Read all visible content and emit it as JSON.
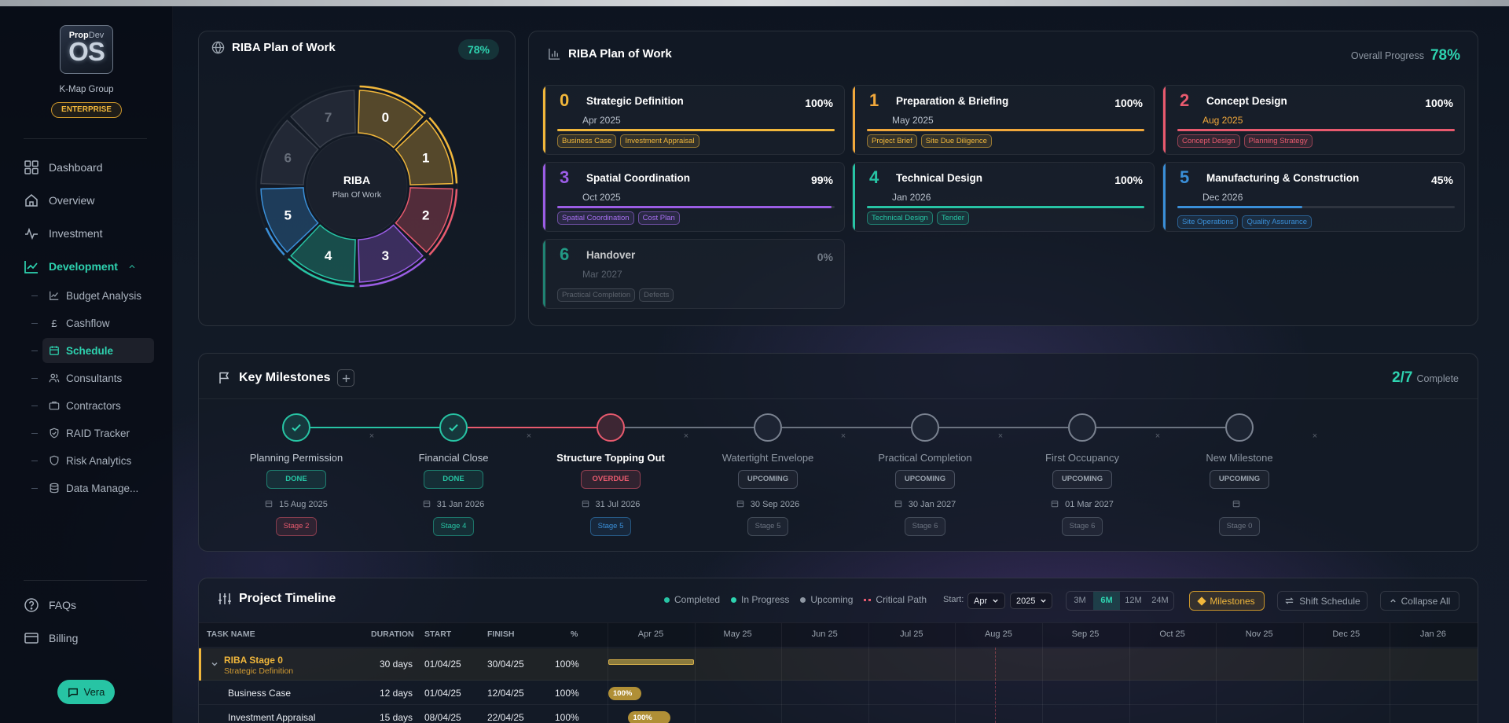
{
  "sidebar": {
    "logo_top": "Prop",
    "logo_top2": "Dev",
    "logo_main": "OS",
    "org": "K-Map Group",
    "plan": "ENTERPRISE",
    "nav": {
      "dashboard": "Dashboard",
      "overview": "Overview",
      "investment": "Investment",
      "development": "Development"
    },
    "sub": {
      "budget": "Budget Analysis",
      "cashflow": "Cashflow",
      "schedule": "Schedule",
      "consultants": "Consultants",
      "contractors": "Contractors",
      "raid": "RAID Tracker",
      "risk": "Risk Analytics",
      "data": "Data Manage..."
    },
    "faqs": "FAQs",
    "billing": "Billing",
    "vera": "Vera"
  },
  "wheel": {
    "title": "RIBA Plan of Work",
    "progress": "78%",
    "center_title": "RIBA",
    "center_sub": "Plan Of Work",
    "segments": [
      {
        "label": "0",
        "color": "#f1b73b",
        "complete": 1
      },
      {
        "label": "1",
        "color": "#f1b73b",
        "complete": 1
      },
      {
        "label": "2",
        "color": "#e85a6e",
        "complete": 1
      },
      {
        "label": "3",
        "color": "#9b5de5",
        "complete": 1
      },
      {
        "label": "4",
        "color": "#27c4a4",
        "complete": 1
      },
      {
        "label": "5",
        "color": "#3a8fd8",
        "complete": 0.45
      },
      {
        "label": "6",
        "color": "#4a5160",
        "complete": 0
      },
      {
        "label": "7",
        "color": "#4a5160",
        "complete": 0
      }
    ]
  },
  "stages_panel": {
    "title": "RIBA Plan of Work",
    "overall_label": "Overall Progress",
    "overall_value": "78%",
    "stages": [
      {
        "num": "0",
        "name": "Strategic Definition",
        "date": "Apr 2025",
        "pct": "100%",
        "progress": 1.0,
        "color": "#f1b73b",
        "tags": [
          "Business Case",
          "Investment Appraisal"
        ],
        "tag_color": "#f1b73b"
      },
      {
        "num": "1",
        "name": "Preparation & Briefing",
        "date": "May 2025",
        "pct": "100%",
        "progress": 1.0,
        "color": "#f1a83b",
        "tags": [
          "Project Brief",
          "Site Due Diligence"
        ],
        "tag_color": "#f1b73b"
      },
      {
        "num": "2",
        "name": "Concept Design",
        "date": "Aug 2025",
        "pct": "100%",
        "progress": 1.0,
        "color": "#e85a6e",
        "tags": [
          "Concept Design",
          "Planning Strategy"
        ],
        "tag_color": "#e85a6e"
      },
      {
        "num": "3",
        "name": "Spatial Coordination",
        "date": "Oct 2025",
        "pct": "99%",
        "progress": 0.99,
        "color": "#9b5de5",
        "tags": [
          "Spatial Coordination",
          "Cost Plan"
        ],
        "tag_color": "#a66ff0"
      },
      {
        "num": "4",
        "name": "Technical Design",
        "date": "Jan 2026",
        "pct": "100%",
        "progress": 1.0,
        "color": "#27c4a4",
        "tags": [
          "Technical Design",
          "Tender"
        ],
        "tag_color": "#27c4a4"
      },
      {
        "num": "5",
        "name": "Manufacturing & Construction",
        "date": "Dec 2026",
        "pct": "45%",
        "progress": 0.45,
        "color": "#3a8fd8",
        "tags": [
          "Site Operations",
          "Quality Assurance"
        ],
        "tag_color": "#3a8fd8"
      },
      {
        "num": "6",
        "name": "Handover",
        "date": "Mar 2027",
        "pct": "0%",
        "progress": 0,
        "color": "#27c4a4",
        "tags": [
          "Practical Completion",
          "Defects"
        ],
        "tag_color": "#5b626c"
      }
    ]
  },
  "milestones": {
    "title": "Key Milestones",
    "count": "2/7",
    "count_label": "Complete",
    "items": [
      {
        "name": "Planning Permission",
        "status": "DONE",
        "date": "15 Aug 2025",
        "stage": "Stage 2",
        "state": "done",
        "stage_color": "#e85a6e"
      },
      {
        "name": "Financial Close",
        "status": "DONE",
        "date": "31 Jan 2026",
        "stage": "Stage 4",
        "state": "done",
        "stage_color": "#27c4a4"
      },
      {
        "name": "Structure Topping Out",
        "status": "OVERDUE",
        "date": "31 Jul 2026",
        "stage": "Stage 5",
        "state": "overdue",
        "stage_color": "#3a8fd8"
      },
      {
        "name": "Watertight Envelope",
        "status": "UPCOMING",
        "date": "30 Sep 2026",
        "stage": "Stage 5",
        "state": "upcoming",
        "stage_color": "#6b7380"
      },
      {
        "name": "Practical Completion",
        "status": "UPCOMING",
        "date": "30 Jan 2027",
        "stage": "Stage 6",
        "state": "upcoming",
        "stage_color": "#6b7380"
      },
      {
        "name": "First Occupancy",
        "status": "UPCOMING",
        "date": "01 Mar 2027",
        "stage": "Stage 6",
        "state": "upcoming",
        "stage_color": "#6b7380"
      },
      {
        "name": "New Milestone",
        "status": "UPCOMING",
        "date": "",
        "stage": "Stage 0",
        "state": "upcoming",
        "stage_color": "#6b7380"
      }
    ]
  },
  "timeline": {
    "title": "Project Timeline",
    "legend": {
      "completed": "Completed",
      "in_progress": "In Progress",
      "upcoming": "Upcoming",
      "critical": "Critical Path"
    },
    "start_label": "Start:",
    "start_month": "Apr",
    "start_year": "2025",
    "ranges": [
      "3M",
      "6M",
      "12M",
      "24M"
    ],
    "active_range": "6M",
    "milestones_btn": "Milestones",
    "shift_btn": "Shift Schedule",
    "collapse_btn": "Collapse All",
    "columns": {
      "task": "TASK NAME",
      "duration": "DURATION",
      "start": "START",
      "finish": "FINISH",
      "pct": "%"
    },
    "months": [
      "Apr 25",
      "May 25",
      "Jun 25",
      "Jul 25",
      "Aug 25",
      "Sep 25",
      "Oct 25",
      "Nov 25",
      "Dec 25",
      "Jan 26"
    ],
    "rows": [
      {
        "name": "RIBA Stage 0",
        "sub": "Strategic Definition",
        "duration": "30 days",
        "start": "01/04/25",
        "finish": "30/04/25",
        "pct": "100%",
        "group": true,
        "bar_start": 0,
        "bar_months": 1,
        "bar_label": ""
      },
      {
        "name": "Business Case",
        "sub": "",
        "duration": "12 days",
        "start": "01/04/25",
        "finish": "12/04/25",
        "pct": "100%",
        "group": false,
        "bar_start": 0,
        "bar_months": 0.4,
        "bar_label": "100%"
      },
      {
        "name": "Investment Appraisal",
        "sub": "",
        "duration": "15 days",
        "start": "08/04/25",
        "finish": "22/04/25",
        "pct": "100%",
        "group": false,
        "bar_start": 0.23,
        "bar_months": 0.5,
        "bar_label": "100%"
      }
    ]
  }
}
